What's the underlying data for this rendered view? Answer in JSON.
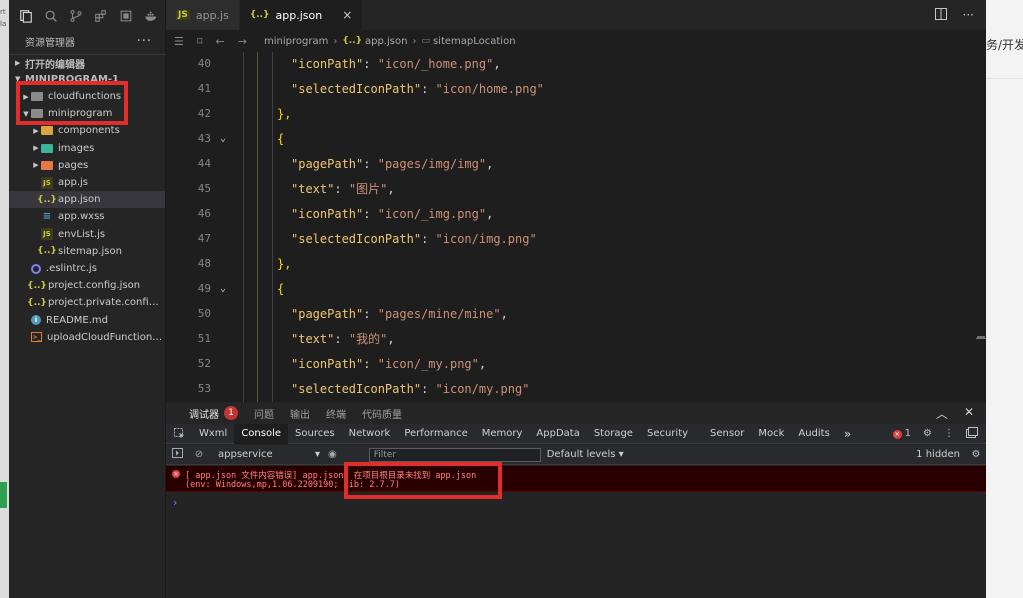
{
  "explorer": {
    "title": "资源管理器",
    "more": "···",
    "open_editors": "打开的编辑器",
    "project_name": "MINIPROGRAM-1",
    "tree": [
      {
        "label": "cloudfunctions",
        "type": "folder",
        "depth": 0,
        "expanded": false
      },
      {
        "label": "miniprogram",
        "type": "folder",
        "depth": 0,
        "expanded": true
      },
      {
        "label": "components",
        "type": "folder",
        "depth": 1,
        "expanded": false
      },
      {
        "label": "images",
        "type": "folder",
        "depth": 1,
        "expanded": false
      },
      {
        "label": "pages",
        "type": "folder",
        "depth": 1,
        "expanded": false
      },
      {
        "label": "app.js",
        "type": "js",
        "depth": 1
      },
      {
        "label": "app.json",
        "type": "json",
        "depth": 1,
        "selected": true
      },
      {
        "label": "app.wxss",
        "type": "wxss",
        "depth": 1
      },
      {
        "label": "envList.js",
        "type": "js",
        "depth": 1
      },
      {
        "label": "sitemap.json",
        "type": "json",
        "depth": 1
      },
      {
        "label": ".eslintrc.js",
        "type": "eslint",
        "depth": 0
      },
      {
        "label": "project.config.json",
        "type": "json",
        "depth": 0
      },
      {
        "label": "project.private.config.js...",
        "type": "json",
        "depth": 0
      },
      {
        "label": "README.md",
        "type": "info",
        "depth": 0
      },
      {
        "label": "uploadCloudFunction.sh",
        "type": "sh",
        "depth": 0
      }
    ]
  },
  "tabs": [
    {
      "label": "app.js",
      "icon": "JS",
      "active": false
    },
    {
      "label": "app.json",
      "icon": "{..}",
      "active": true,
      "close": "×"
    }
  ],
  "breadcrumb": {
    "parts": [
      "miniprogram",
      "app.json",
      "sitemapLocation"
    ]
  },
  "editor": {
    "lines": [
      {
        "n": "40",
        "indent": 4,
        "key": "iconPath",
        "value": "icon/_home.png",
        "trail": ","
      },
      {
        "n": "41",
        "indent": 4,
        "key": "selectedIconPath",
        "value": "icon/home.png",
        "trail": ""
      },
      {
        "n": "42",
        "indent": 3,
        "raw": "},",
        "fold": false
      },
      {
        "n": "43",
        "indent": 3,
        "raw": "{",
        "fold": true
      },
      {
        "n": "44",
        "indent": 4,
        "key": "pagePath",
        "value": "pages/img/img",
        "trail": ","
      },
      {
        "n": "45",
        "indent": 4,
        "key": "text",
        "value": "图片",
        "trail": ","
      },
      {
        "n": "46",
        "indent": 4,
        "key": "iconPath",
        "value": "icon/_img.png",
        "trail": ","
      },
      {
        "n": "47",
        "indent": 4,
        "key": "selectedIconPath",
        "value": "icon/img.png",
        "trail": ""
      },
      {
        "n": "48",
        "indent": 3,
        "raw": "},",
        "fold": false
      },
      {
        "n": "49",
        "indent": 3,
        "raw": "{",
        "fold": true
      },
      {
        "n": "50",
        "indent": 4,
        "key": "pagePath",
        "value": "pages/mine/mine",
        "trail": ","
      },
      {
        "n": "51",
        "indent": 4,
        "key": "text",
        "value": "我的",
        "trail": ","
      },
      {
        "n": "52",
        "indent": 4,
        "key": "iconPath",
        "value": "icon/_my.png",
        "trail": ","
      },
      {
        "n": "53",
        "indent": 4,
        "key": "selectedIconPath",
        "value": "icon/my.png",
        "trail": ""
      }
    ]
  },
  "panel": {
    "tabs": [
      {
        "label": "调试器",
        "active": true,
        "badge": "1"
      },
      {
        "label": "问题"
      },
      {
        "label": "输出"
      },
      {
        "label": "终端"
      },
      {
        "label": "代码质量"
      }
    ]
  },
  "devtools": {
    "tabs": [
      "Wxml",
      "Console",
      "Sources",
      "Network",
      "Performance",
      "Memory",
      "AppData",
      "Storage",
      "Security",
      "Sensor",
      "Mock",
      "Audits"
    ],
    "active": "Console",
    "overflow": "»",
    "error_count": "1"
  },
  "console_toolbar": {
    "context": "appservice",
    "filter_placeholder": "Filter",
    "levels": "Default levels ▾",
    "hidden": "1 hidden"
  },
  "console": {
    "error_line1": "[ app.json 文件内容错误] app.json: 在项目根目录未找到 app.json",
    "error_line2": "(env: Windows,mp,1.06.2209190; lib: 2.7.7)",
    "prompt": "›"
  },
  "right_edge_text": "务/开发",
  "colors": {
    "accent_red": "#e22d2d",
    "error_bg": "#290000",
    "editor_bg": "#1e1e1e",
    "json_key": "#f0c674",
    "json_string": "#ce9178"
  }
}
